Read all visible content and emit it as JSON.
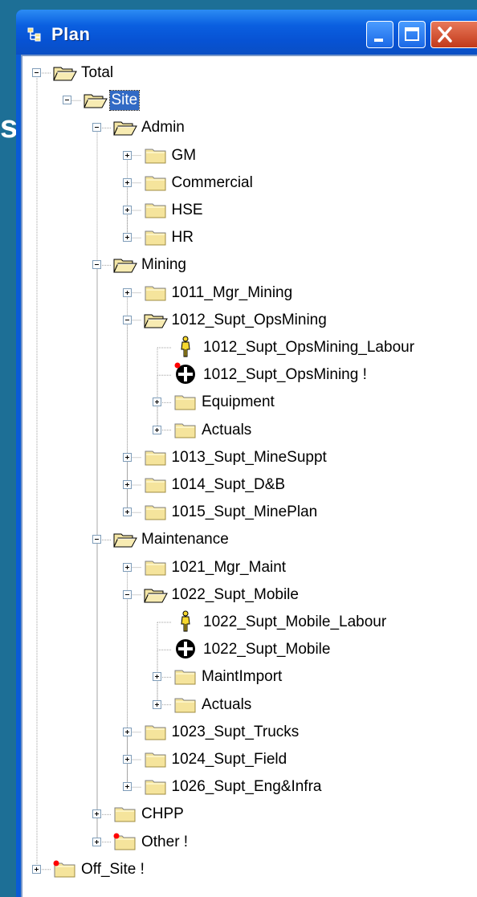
{
  "window": {
    "title": "Plan",
    "buttons": [
      "minimize",
      "maximize",
      "close"
    ],
    "colors": {
      "titlebar": "#0a5fe0",
      "selection": "#316ac5",
      "folder": "#f5e49c",
      "warning_dot": "#ff0000"
    }
  },
  "tree": [
    {
      "label": "Total",
      "icon": "folder-open-icon",
      "expander": "minus"
    },
    {
      "label": "Site",
      "icon": "folder-open-icon",
      "expander": "minus",
      "selected": true
    },
    {
      "label": "Admin",
      "icon": "folder-open-icon",
      "expander": "minus"
    },
    {
      "label": "GM",
      "icon": "folder-icon",
      "expander": "plus"
    },
    {
      "label": "Commercial",
      "icon": "folder-icon",
      "expander": "plus"
    },
    {
      "label": "HSE",
      "icon": "folder-icon",
      "expander": "plus"
    },
    {
      "label": "HR",
      "icon": "folder-icon",
      "expander": "plus"
    },
    {
      "label": "Mining",
      "icon": "folder-open-icon",
      "expander": "minus"
    },
    {
      "label": "1011_Mgr_Mining",
      "icon": "folder-icon",
      "expander": "plus"
    },
    {
      "label": "1012_Supt_OpsMining",
      "icon": "folder-open-icon",
      "expander": "minus"
    },
    {
      "label": "1012_Supt_OpsMining_Labour",
      "icon": "person-icon",
      "expander": "none"
    },
    {
      "label": "1012_Supt_OpsMining !",
      "icon": "equipment-icon",
      "expander": "none",
      "warning": true
    },
    {
      "label": "Equipment",
      "icon": "folder-icon",
      "expander": "plus"
    },
    {
      "label": "Actuals",
      "icon": "folder-icon",
      "expander": "plus"
    },
    {
      "label": "1013_Supt_MineSuppt",
      "icon": "folder-icon",
      "expander": "plus"
    },
    {
      "label": "1014_Supt_D&B",
      "icon": "folder-icon",
      "expander": "plus"
    },
    {
      "label": "1015_Supt_MinePlan",
      "icon": "folder-icon",
      "expander": "plus"
    },
    {
      "label": "Maintenance",
      "icon": "folder-open-icon",
      "expander": "minus"
    },
    {
      "label": "1021_Mgr_Maint",
      "icon": "folder-icon",
      "expander": "plus"
    },
    {
      "label": "1022_Supt_Mobile",
      "icon": "folder-open-icon",
      "expander": "minus"
    },
    {
      "label": "1022_Supt_Mobile_Labour",
      "icon": "person-icon",
      "expander": "none"
    },
    {
      "label": "1022_Supt_Mobile",
      "icon": "equipment-icon",
      "expander": "none"
    },
    {
      "label": "MaintImport",
      "icon": "folder-icon",
      "expander": "plus"
    },
    {
      "label": "Actuals",
      "icon": "folder-icon",
      "expander": "plus"
    },
    {
      "label": "1023_Supt_Trucks",
      "icon": "folder-icon",
      "expander": "plus"
    },
    {
      "label": "1024_Supt_Field",
      "icon": "folder-icon",
      "expander": "plus"
    },
    {
      "label": "1026_Supt_Eng&Infra",
      "icon": "folder-icon",
      "expander": "plus"
    },
    {
      "label": "CHPP",
      "icon": "folder-icon",
      "expander": "plus"
    },
    {
      "label": "Other !",
      "icon": "folder-icon",
      "expander": "plus",
      "warning": true
    },
    {
      "label": "Off_Site !",
      "icon": "folder-icon",
      "expander": "plus",
      "warning": true
    }
  ]
}
